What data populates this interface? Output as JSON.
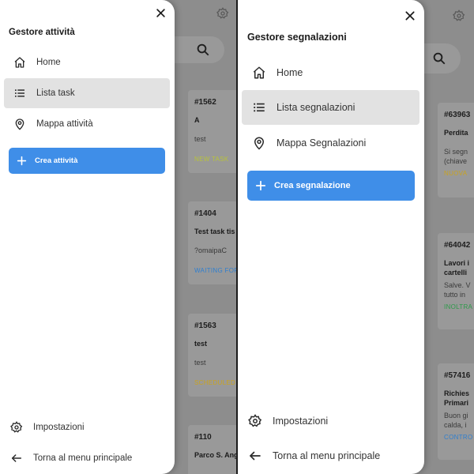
{
  "screens": [
    {
      "drawer": {
        "title": "Gestore attività",
        "nav": [
          {
            "label": "Home",
            "icon": "home-icon"
          },
          {
            "label": "Lista task",
            "icon": "list-icon",
            "selected": true
          },
          {
            "label": "Mappa attività",
            "icon": "map-pin-icon"
          }
        ],
        "create_label": "Crea attività",
        "footer": [
          {
            "label": "Impostazioni",
            "icon": "gear-icon"
          },
          {
            "label": "Torna al menu principale",
            "icon": "arrow-left-icon"
          }
        ]
      },
      "background": {
        "cards": [
          {
            "id": "#1562",
            "title": "A",
            "desc": "test",
            "status": "NEW TASK",
            "status_color": "#b8c33a"
          },
          {
            "id": "#1404",
            "title": "Test task tis",
            "desc": "?omaipaC",
            "status": "WAITING FOR",
            "status_color": "#2f7fcf"
          },
          {
            "id": "#1563",
            "title": "test",
            "desc": "test",
            "status": "SCHEDULED",
            "status_color": "#c9a320"
          },
          {
            "id": "#110",
            "title": "Parco S. Ang",
            "desc": "",
            "status": "",
            "status_color": "#555555"
          }
        ]
      }
    },
    {
      "drawer": {
        "title": "Gestore segnalazioni",
        "nav": [
          {
            "label": "Home",
            "icon": "home-icon"
          },
          {
            "label": "Lista segnalazioni",
            "icon": "list-icon",
            "selected": true
          },
          {
            "label": "Mappa Segnalazioni",
            "icon": "map-pin-icon"
          }
        ],
        "create_label": "Crea segnalazione",
        "footer": [
          {
            "label": "Impostazioni",
            "icon": "gear-icon"
          },
          {
            "label": "Torna al menu principale",
            "icon": "arrow-left-icon"
          }
        ]
      },
      "background": {
        "cards": [
          {
            "id": "#63963",
            "title": "Perdita",
            "desc": "Si segn",
            "desc2": "(chiave",
            "status": "NUOVA",
            "status_color": "#c9a320"
          },
          {
            "id": "#64042",
            "title": "Lavori i",
            "title2": "cartelli",
            "desc": "Salve. V",
            "desc2": "tutto in",
            "status": "INOLTRA",
            "status_color": "#2e9a4a"
          },
          {
            "id": "#57416",
            "title": "Richies",
            "title2": "Primari",
            "desc": "Buon gi",
            "desc2": "calda, i",
            "status": "CONTRO",
            "status_color": "#2f7fcf"
          }
        ]
      }
    }
  ]
}
